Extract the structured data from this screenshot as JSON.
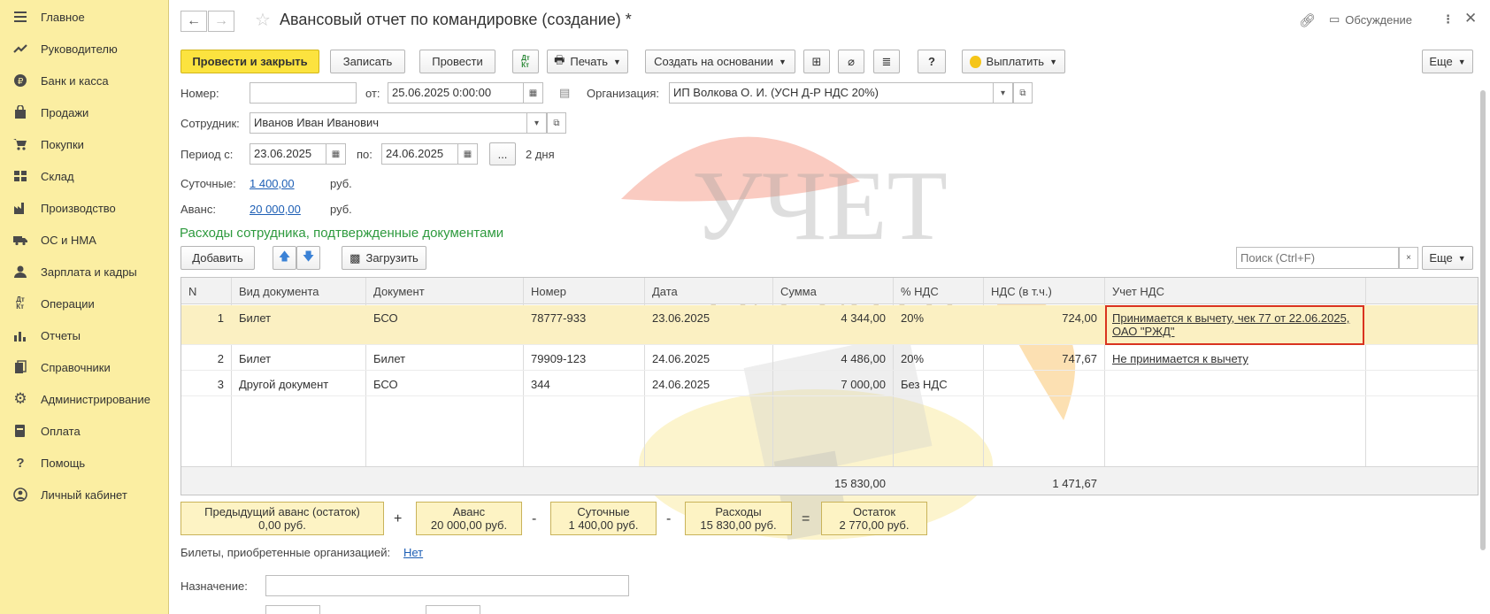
{
  "sidebar": {
    "items": [
      {
        "label": "Главное",
        "icon": "menu-icon"
      },
      {
        "label": "Руководителю",
        "icon": "trend-icon"
      },
      {
        "label": "Банк и касса",
        "icon": "coin-icon"
      },
      {
        "label": "Продажи",
        "icon": "bag-icon"
      },
      {
        "label": "Покупки",
        "icon": "cart-icon"
      },
      {
        "label": "Склад",
        "icon": "warehouse-icon"
      },
      {
        "label": "Производство",
        "icon": "factory-icon"
      },
      {
        "label": "ОС и НМА",
        "icon": "truck-icon"
      },
      {
        "label": "Зарплата и кадры",
        "icon": "person-icon"
      },
      {
        "label": "Операции",
        "icon": "dt-kt-icon"
      },
      {
        "label": "Отчеты",
        "icon": "bar-chart-icon"
      },
      {
        "label": "Справочники",
        "icon": "books-icon"
      },
      {
        "label": "Администрирование",
        "icon": "gear-icon"
      },
      {
        "label": "Оплата",
        "icon": "payment-icon"
      },
      {
        "label": "Помощь",
        "icon": "help-icon"
      },
      {
        "label": "Личный кабинет",
        "icon": "account-icon"
      }
    ]
  },
  "header": {
    "title": "Авансовый отчет по командировке (создание) *",
    "discussion": "Обсуждение"
  },
  "toolbar": {
    "post_close": "Провести и закрыть",
    "save": "Записать",
    "post": "Провести",
    "dtkt": "Дт Кт",
    "print": "Печать",
    "create_based": "Создать на основании",
    "help": "?",
    "pay": "Выплатить",
    "more": "Еще"
  },
  "form": {
    "number_label": "Номер:",
    "number_value": "",
    "from_label": "от:",
    "date_value": "25.06.2025  0:00:00",
    "org_label": "Организация:",
    "org_value": "ИП Волкова О. И. (УСН Д-Р НДС 20%)",
    "employee_label": "Сотрудник:",
    "employee_value": "Иванов Иван Иванович",
    "period_label": "Период с:",
    "period_from": "23.06.2025",
    "period_to_label": "по:",
    "period_to": "24.06.2025",
    "period_btn": "...",
    "period_days": "2 дня",
    "daily_label": "Суточные:",
    "daily_value": "1 400,00",
    "daily_cur": "руб.",
    "advance_label": "Аванс:",
    "advance_value": "20 000,00",
    "advance_cur": "руб."
  },
  "section": {
    "title": "Расходы сотрудника, подтвержденные документами",
    "add": "Добавить",
    "load": "Загрузить",
    "search_placeholder": "Поиск (Ctrl+F)",
    "search_clear": "×",
    "more": "Еще"
  },
  "table": {
    "columns": [
      "N",
      "Вид документа",
      "Документ",
      "Номер",
      "Дата",
      "Сумма",
      "% НДС",
      "НДС (в т.ч.)",
      "Учет НДС"
    ],
    "rows": [
      {
        "n": "1",
        "kind": "Билет",
        "doc": "БСО",
        "num": "78777-933",
        "date": "23.06.2025",
        "sum": "4 344,00",
        "vat_rate": "20%",
        "vat": "724,00",
        "vat_acc": "Принимается к вычету, чек 77 от 22.06.2025, ОАО \"РЖД\""
      },
      {
        "n": "2",
        "kind": "Билет",
        "doc": "Билет",
        "num": "79909-123",
        "date": "24.06.2025",
        "sum": "4 486,00",
        "vat_rate": "20%",
        "vat": "747,67",
        "vat_acc": "Не принимается к вычету"
      },
      {
        "n": "3",
        "kind": "Другой документ",
        "doc": "БСО",
        "num": "344",
        "date": "24.06.2025",
        "sum": "7 000,00",
        "vat_rate": "Без НДС",
        "vat": "",
        "vat_acc": ""
      }
    ],
    "total_sum": "15 830,00",
    "total_vat": "1 471,67"
  },
  "totals": {
    "prev_label": "Предыдущий аванс (остаток)",
    "prev_value": "0,00 руб.",
    "plus": "+",
    "advance_label": "Аванс",
    "advance_value": "20 000,00 руб.",
    "minus1": "-",
    "daily_label": "Суточные",
    "daily_value": "1 400,00 руб.",
    "minus2": "-",
    "exp_label": "Расходы",
    "exp_value": "15 830,00 руб.",
    "eq": "=",
    "rest_label": "Остаток",
    "rest_value": "2 770,00 руб."
  },
  "footer": {
    "tickets_label": "Билеты, приобретенные организацией:",
    "tickets_value": "Нет",
    "purpose_label": "Назначение:",
    "purpose_value": ""
  },
  "watermark": {
    "line1": "УЧЕТ",
    "line2": "БЕЗ ЗАБОТ"
  }
}
